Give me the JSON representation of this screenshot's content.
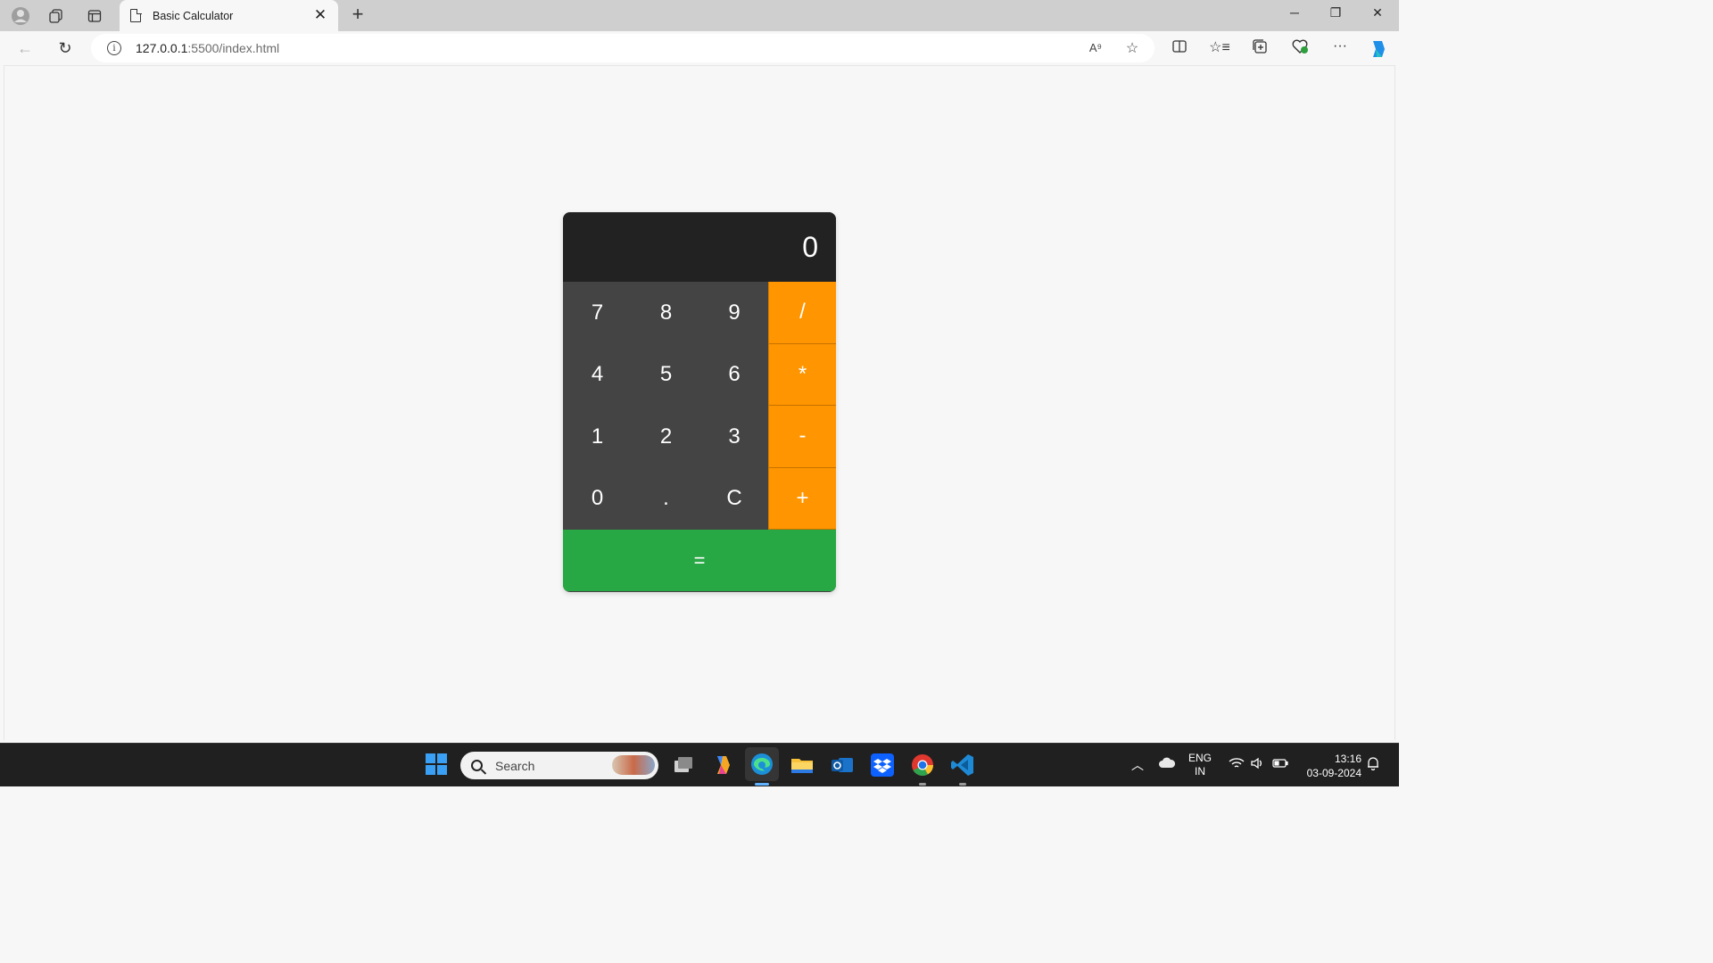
{
  "browser": {
    "tab_title": "Basic Calculator",
    "url_host": "127.0.0.1",
    "url_rest": ":5500/index.html",
    "read_aloud_label": "A⁹"
  },
  "calculator": {
    "display": "0",
    "keys": [
      "7",
      "8",
      "9",
      "/",
      "4",
      "5",
      "6",
      "*",
      "1",
      "2",
      "3",
      "-",
      "0",
      ".",
      "C",
      "+"
    ],
    "equals": "="
  },
  "taskbar": {
    "search_placeholder": "Search",
    "lang_top": "ENG",
    "lang_bottom": "IN",
    "time": "13:16",
    "date": "03-09-2024"
  },
  "colors": {
    "display_bg": "#222222",
    "key_bg": "#444444",
    "operator_bg": "#ff9500",
    "equals_bg": "#28a745"
  }
}
